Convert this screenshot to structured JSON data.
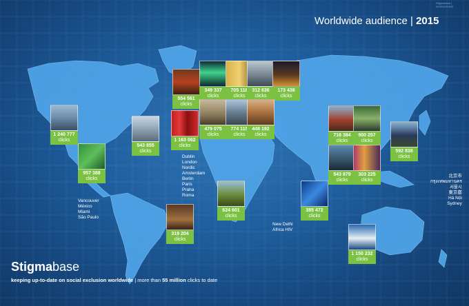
{
  "header": {
    "title": "Worldwide audience",
    "separator": "|",
    "year": "2015"
  },
  "brand": {
    "name_bold": "Stigma",
    "name_regular": "base",
    "tagline_bold": "keeping up-to-date on social exclusion worldwide",
    "tagline_sep": " | ",
    "tagline_pre": "more than ",
    "tagline_num": "55 million",
    "tagline_post": " clicks to date"
  },
  "unit": "clicks",
  "tiles": [
    {
      "id": "usa",
      "value": "1 240 777",
      "photo": "city-skyline"
    },
    {
      "id": "canada",
      "value": "957 388",
      "photo": "green-sign"
    },
    {
      "id": "mexico",
      "value": "319 204",
      "photo": "latin-town"
    },
    {
      "id": "uk",
      "value": "543 855",
      "photo": "city-street"
    },
    {
      "id": "ireland",
      "value": "1 163 062",
      "photo": "red-phone-booths"
    },
    {
      "id": "london",
      "value": "554 561",
      "photo": "red-bus-street"
    },
    {
      "id": "nordic",
      "value": "349 337",
      "photo": "aurora"
    },
    {
      "id": "europe2",
      "value": "705 118",
      "photo": "yellow-building"
    },
    {
      "id": "europe3",
      "value": "312 636",
      "photo": "european-city"
    },
    {
      "id": "europe4",
      "value": "173 438",
      "photo": "night-bridge"
    },
    {
      "id": "europe5",
      "value": "479 075",
      "photo": "street-cafe"
    },
    {
      "id": "europe6",
      "value": "774 115",
      "photo": "cathedral"
    },
    {
      "id": "europe7",
      "value": "448 192",
      "photo": "old-town"
    },
    {
      "id": "africa",
      "value": "624 601",
      "photo": "acacia-tree"
    },
    {
      "id": "india",
      "value": "385 472",
      "photo": "blue-arch"
    },
    {
      "id": "asia1",
      "value": "716 384",
      "photo": "temple"
    },
    {
      "id": "asia2",
      "value": "900 257",
      "photo": "korean-street"
    },
    {
      "id": "asia3",
      "value": "543 879",
      "photo": "asian-city"
    },
    {
      "id": "asia4",
      "value": "303 225",
      "photo": "neon-street"
    },
    {
      "id": "japan",
      "value": "592 838",
      "photo": "japanese-castle"
    },
    {
      "id": "australia",
      "value": "1 150 232",
      "photo": "opera-house"
    }
  ],
  "cities": {
    "americas": "Vancouver\nMéxico\nMiami\nSão Paulo",
    "europe": "Dublin\nLondon\nNordic\nAmsterdam\nBerlin\nParis\nPraha\nRoma",
    "india": "New Delhi\nAfrica HIV",
    "asia": "北京市\nกรุงเทพมหานคร\n서울시\n東京都\nHà Nội\nSydney"
  },
  "credit": "Stigmabase | WORLDWIDE",
  "colors": {
    "ocean": "#1f5e9e",
    "land": "#4ea3e6",
    "label": "#7cc242",
    "text": "#ffffff"
  }
}
